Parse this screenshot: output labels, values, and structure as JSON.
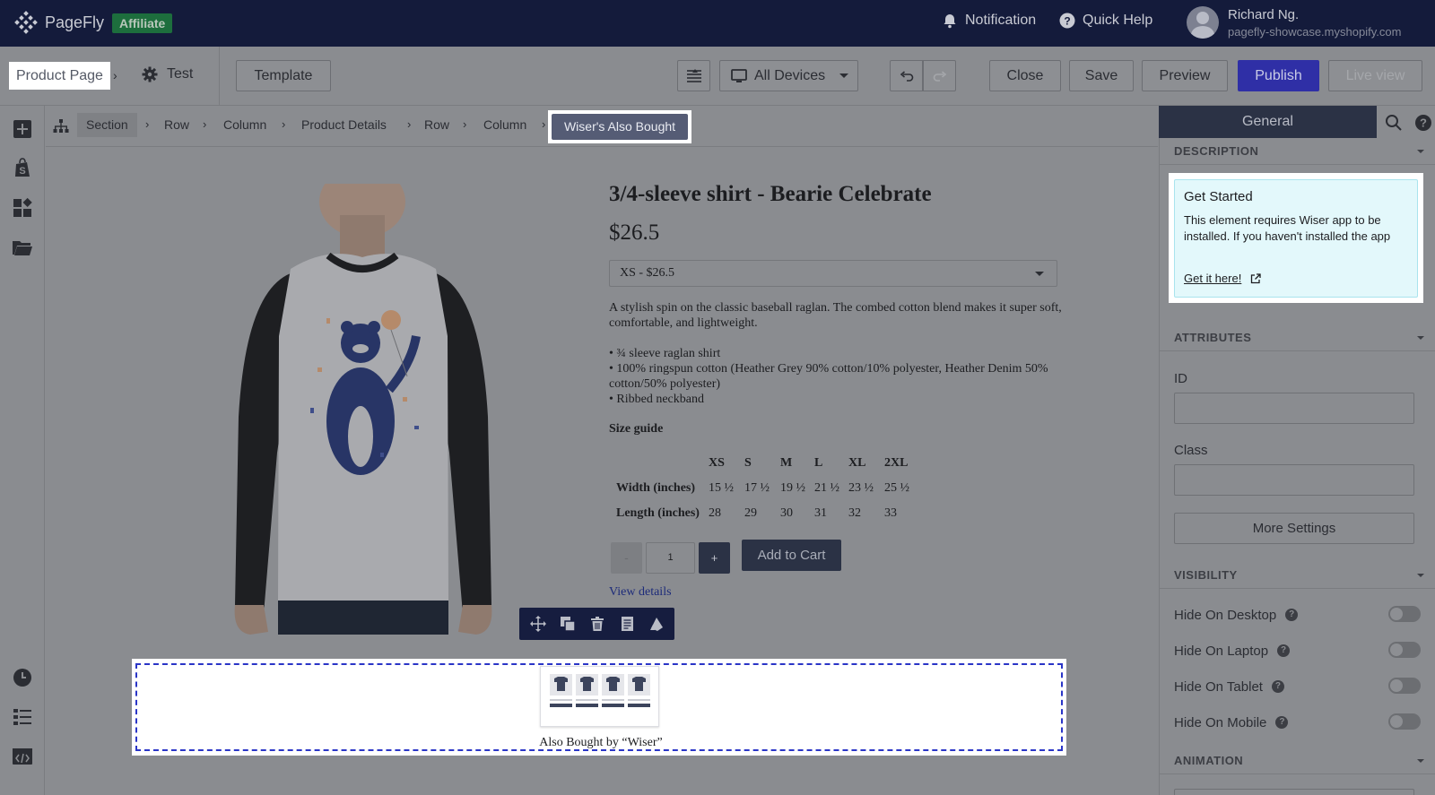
{
  "topbar": {
    "brand": "PageFly",
    "badge": "Affiliate",
    "notification": "Notification",
    "quick_help": "Quick Help",
    "user_name": "Richard Ng.",
    "user_shop": "pagefly-showcase.myshopify.com"
  },
  "toolbar": {
    "page_type": "Product Page",
    "page_name": "Test",
    "template": "Template",
    "devices": "All Devices",
    "close": "Close",
    "save": "Save",
    "preview": "Preview",
    "publish": "Publish",
    "live_view": "Live view"
  },
  "breadcrumb": [
    "Section",
    "Row",
    "Column",
    "Product Details",
    "Row",
    "Column"
  ],
  "breadcrumb_active": "Wiser's Also Bought",
  "product": {
    "title": "3/4-sleeve shirt - Bearie Celebrate",
    "price": "$26.5",
    "variant": "XS - $26.5",
    "description": "A stylish spin on the classic baseball raglan. The combed cotton blend makes it super soft, comfortable, and lightweight.",
    "bullets": [
      "• ¾ sleeve raglan shirt",
      "• 100% ringspun cotton (Heather Grey 90% cotton/10% polyester, Heather Denim 50% cotton/50% polyester)",
      "• Ribbed neckband"
    ],
    "size_guide": "Size guide",
    "size_table": {
      "headers": [
        "",
        "XS",
        "S",
        "M",
        "L",
        "XL",
        "2XL"
      ],
      "rows": [
        [
          "Width (inches)",
          "15 ½",
          "17 ½",
          "19 ½",
          "21 ½",
          "23 ½",
          "25 ½"
        ],
        [
          "Length (inches)",
          "28",
          "29",
          "30",
          "31",
          "32",
          "33"
        ]
      ]
    },
    "qty_minus": "-",
    "qty_value": "1",
    "qty_plus": "+",
    "add_to_cart": "Add to Cart",
    "view_details": "View details"
  },
  "wiser": {
    "caption": "Also Bought by “Wiser”"
  },
  "panel": {
    "tab": "General",
    "description_head": "DESCRIPTION",
    "gs_title": "Get Started",
    "gs_text": "This element requires Wiser app to be installed. If you haven't installed the app",
    "gs_link": "Get it here!",
    "attributes_head": "ATTRIBUTES",
    "id_label": "ID",
    "class_label": "Class",
    "more_settings": "More Settings",
    "visibility_head": "VISIBILITY",
    "visibility": [
      {
        "label": "Hide On Desktop"
      },
      {
        "label": "Hide On Laptop"
      },
      {
        "label": "Hide On Tablet"
      },
      {
        "label": "Hide On Mobile"
      }
    ],
    "animation_head": "ANIMATION"
  }
}
